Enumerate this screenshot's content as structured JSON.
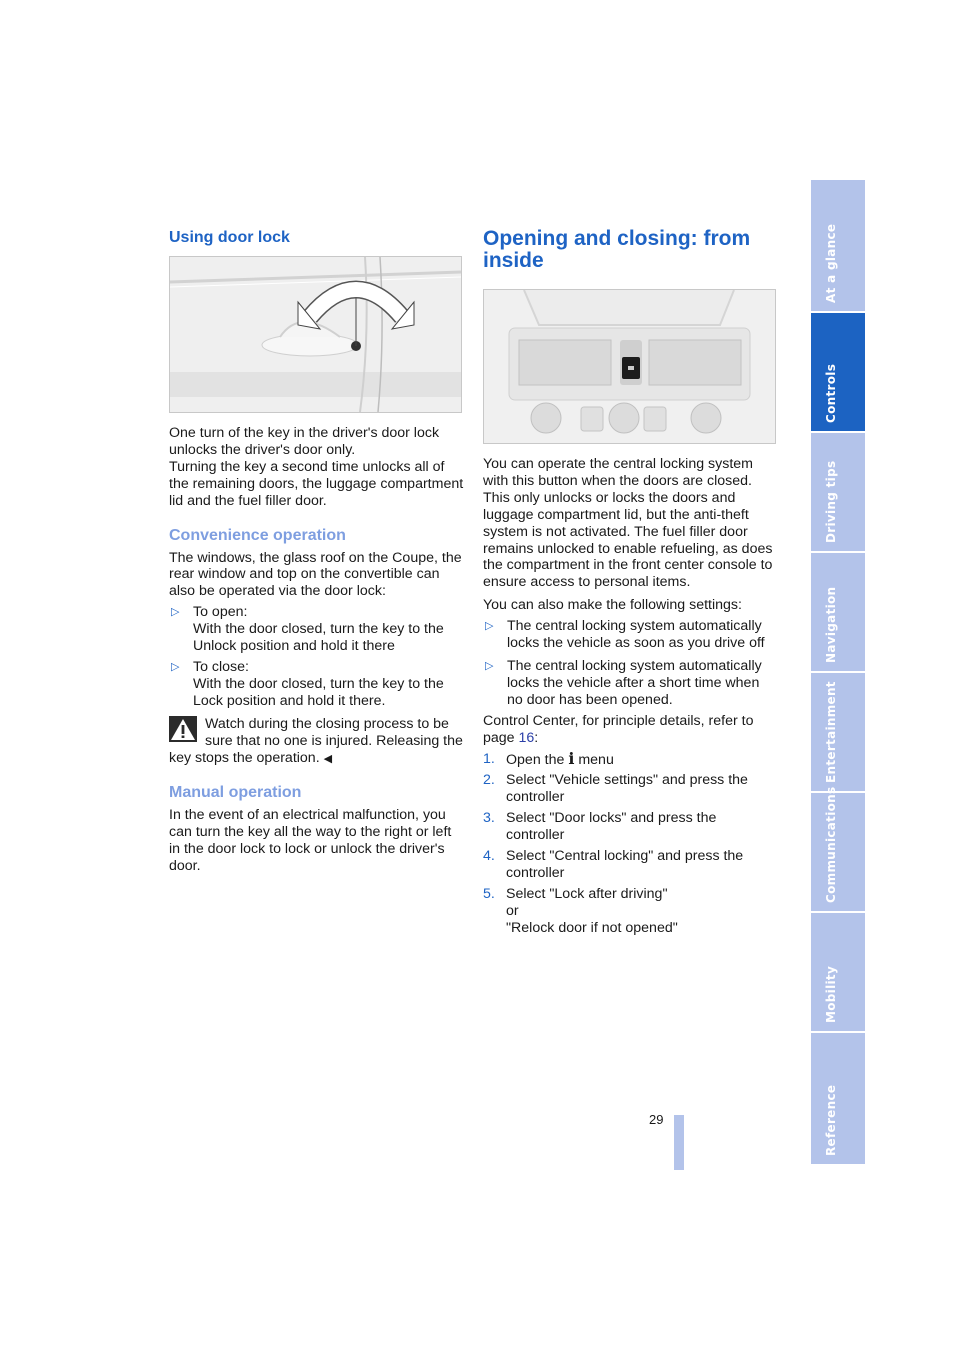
{
  "left": {
    "heading": "Using door lock",
    "figure": {
      "name": "door-lock-illustration",
      "description": "Door handle with key turning arrows"
    },
    "intro": [
      "One turn of the key in the driver's door lock unlocks the driver's door only.",
      "Turning the key a second time unlocks all of the remaining doors, the luggage compartment lid and the fuel filler door."
    ],
    "convenience": {
      "heading": "Convenience operation",
      "text": "The windows, the glass roof on the Coupe, the rear window and top on the convertible can also be operated via the door lock:",
      "bullets": [
        {
          "title": "To open:",
          "text": "With the door closed, turn the key to the Unlock position and hold it there"
        },
        {
          "title": "To close:",
          "text": "With the door closed, turn the key to the Lock position and hold it there."
        }
      ],
      "warning": "Watch during the closing process to be sure that no one is injured. Releasing the key stops the operation.",
      "warning_end": "◀"
    },
    "manual": {
      "heading": "Manual operation",
      "text": "In the event of an electrical malfunction, you can turn the key all the way to the right or left in the door lock to lock or unlock the driver's door."
    }
  },
  "right": {
    "heading": "Opening and closing: from inside",
    "figure": {
      "name": "center-console-illustration",
      "description": "Center console with central locking button"
    },
    "paragraph": "You can operate the central locking system with this button when the doors are closed. This only unlocks or locks the doors and luggage compartment lid, but the anti-theft system is not activated. The fuel filler door remains unlocked to enable refueling, as does the compartment in the front center console to ensure access to personal items.",
    "settings_intro": "You can also make the following settings:",
    "settings": [
      "The central locking system automatically locks the vehicle as soon as you drive off",
      "The central locking system automatically locks the vehicle after a short time when no door has been opened."
    ],
    "control_center_prefix": "Control Center, for principle details, refer to page ",
    "control_center_page": "16",
    "control_center_suffix": ":",
    "steps": [
      {
        "n": "1.",
        "text_before": "Open the ",
        "icon": "info-icon",
        "text_after": " menu"
      },
      {
        "n": "2.",
        "text": "Select \"Vehicle settings\" and press the controller"
      },
      {
        "n": "3.",
        "text": "Select \"Door locks\" and press the controller"
      },
      {
        "n": "4.",
        "text": "Select \"Central locking\" and press the controller"
      },
      {
        "n": "5.",
        "text": "Select \"Lock after driving\"",
        "or": "or",
        "alt": "\"Relock door if not opened\""
      }
    ]
  },
  "tabs": [
    {
      "label": "At a glance",
      "active": false
    },
    {
      "label": "Controls",
      "active": true
    },
    {
      "label": "Driving tips",
      "active": false
    },
    {
      "label": "Navigation",
      "active": false
    },
    {
      "label": "Entertainment",
      "active": false
    },
    {
      "label": "Communications",
      "active": false
    },
    {
      "label": "Mobility",
      "active": false
    },
    {
      "label": "Reference",
      "active": false
    }
  ],
  "page_number": "29",
  "colors": {
    "heading": "#1e63c4",
    "subheading": "#7e9ee0",
    "tab": "#b3c3ea",
    "tab_active": "#1c63c2"
  }
}
